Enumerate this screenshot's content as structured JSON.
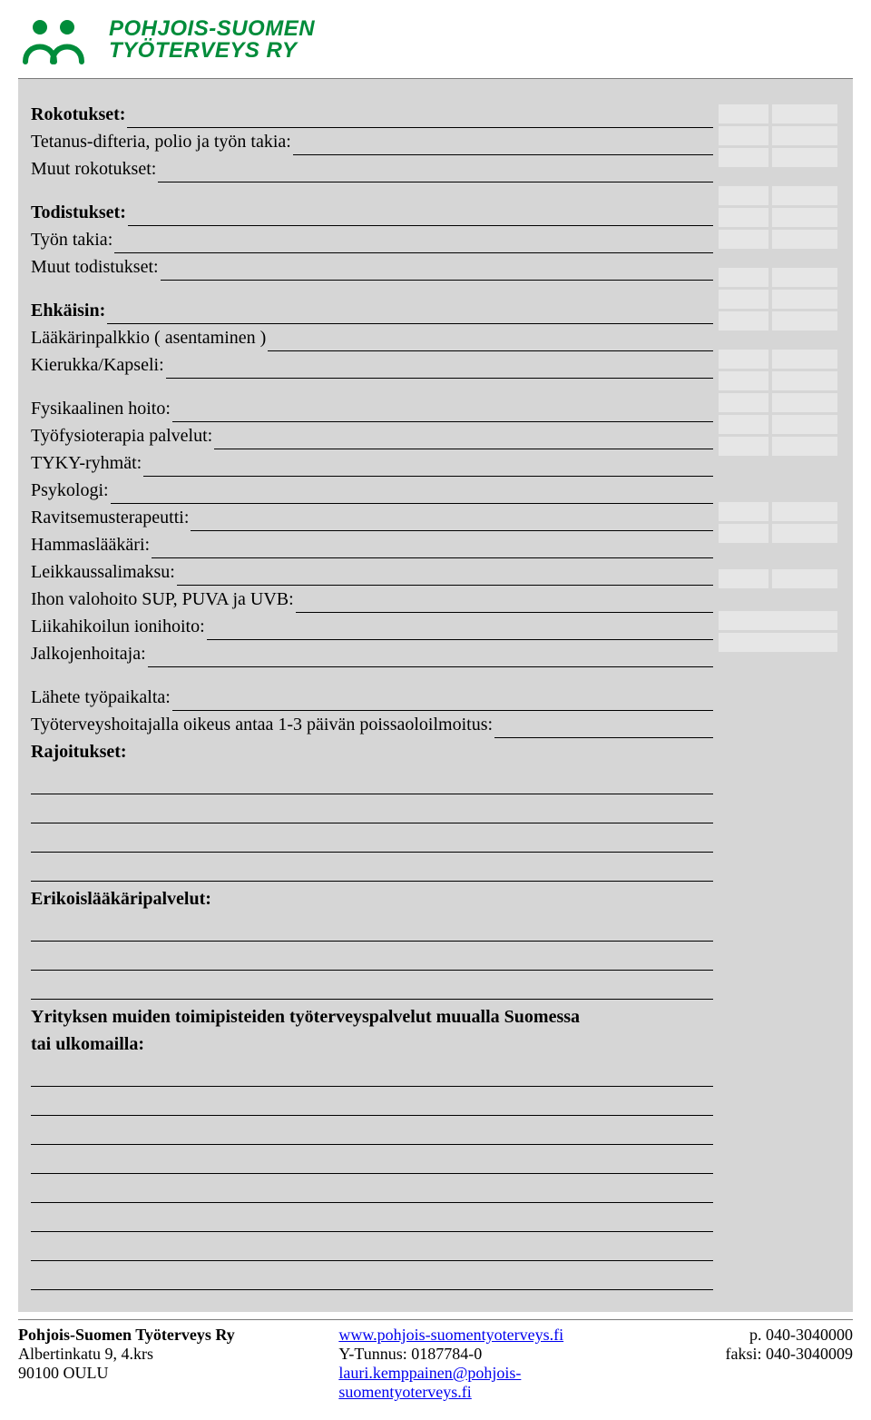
{
  "logo": {
    "line1": "POHJOIS-SUOMEN",
    "line2": "TYÖTERVEYS RY"
  },
  "sections": {
    "rokotukset": {
      "title": "Rokotukset:",
      "items": [
        "Tetanus-difteria, polio ja työn takia:",
        "Muut rokotukset:"
      ]
    },
    "todistukset": {
      "title": "Todistukset:",
      "items": [
        "Työn takia:",
        "Muut todistukset:"
      ]
    },
    "ehkaisin": {
      "title": "Ehkäisin:",
      "items": [
        "Lääkärinpalkkio ( asentaminen )",
        "Kierukka/Kapseli:"
      ]
    },
    "fysikaalinen": {
      "items": [
        "Fysikaalinen hoito:",
        "Työfysioterapia palvelut:",
        "TYKY-ryhmät:",
        "Psykologi:",
        "Ravitsemusterapeutti:",
        "Hammaslääkäri:",
        "Leikkaussalimaksu:",
        "Ihon valohoito SUP, PUVA ja UVB:",
        "Liikahikoilun ionihoito:",
        "Jalkojenhoitaja:"
      ]
    },
    "lahete": {
      "line1": "Lähete työpaikalta:",
      "line2": "Työterveyshoitajalla oikeus antaa 1-3 päivän poissaoloilmoitus:",
      "rajoitukset": "Rajoitukset:"
    },
    "erikois": "Erikoislääkäripalvelut:",
    "yrityksen": {
      "l1": "Yrityksen muiden toimipisteiden työterveyspalvelut muualla Suomessa",
      "l2": "tai ulkomailla:"
    }
  },
  "footer": {
    "company": "Pohjois-Suomen Työterveys Ry",
    "addr1": "Albertinkatu 9,  4.krs",
    "addr2": "90100 OULU",
    "web": "www.pohjois-suomentyoterveys.fi",
    "ytunnus": "Y-Tunnus:  0187784-0",
    "email": "lauri.kemppainen@pohjois-suomentyoterveys.fi",
    "phone": "p.  040-3040000",
    "fax": "faksi: 040-3040009"
  }
}
